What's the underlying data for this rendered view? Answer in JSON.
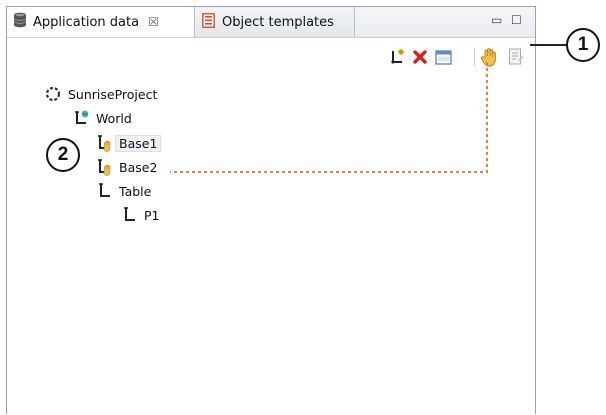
{
  "tabs": {
    "active": {
      "label": "Application data",
      "close_glyph": "☒",
      "icon": "database-icon"
    },
    "inactive": {
      "label": "Object templates",
      "icon": "template-icon"
    }
  },
  "window_controls": {
    "minimize_glyph": "▭",
    "maximize_glyph": "☐"
  },
  "toolbar": {
    "items": [
      "add-frame-icon",
      "delete-icon",
      "view-icon",
      "teach-hand-icon",
      "properties-icon"
    ],
    "delete_color": "#e02020",
    "teach_color": "#e8a020"
  },
  "tree": {
    "root": {
      "label": "SunriseProject",
      "icon": "project-icon"
    },
    "world": {
      "label": "World",
      "icon": "world-frame-icon"
    },
    "base1": {
      "label": "Base1",
      "icon": "base-frame-icon"
    },
    "base2": {
      "label": "Base2",
      "icon": "base-frame-icon"
    },
    "table": {
      "label": "Table",
      "icon": "frame-icon"
    },
    "p1": {
      "label": "P1",
      "icon": "frame-icon"
    }
  },
  "callouts": {
    "one": "1",
    "two": "2"
  },
  "colors": {
    "accent_orange": "#e8823a",
    "border": "#9aa3ad"
  }
}
